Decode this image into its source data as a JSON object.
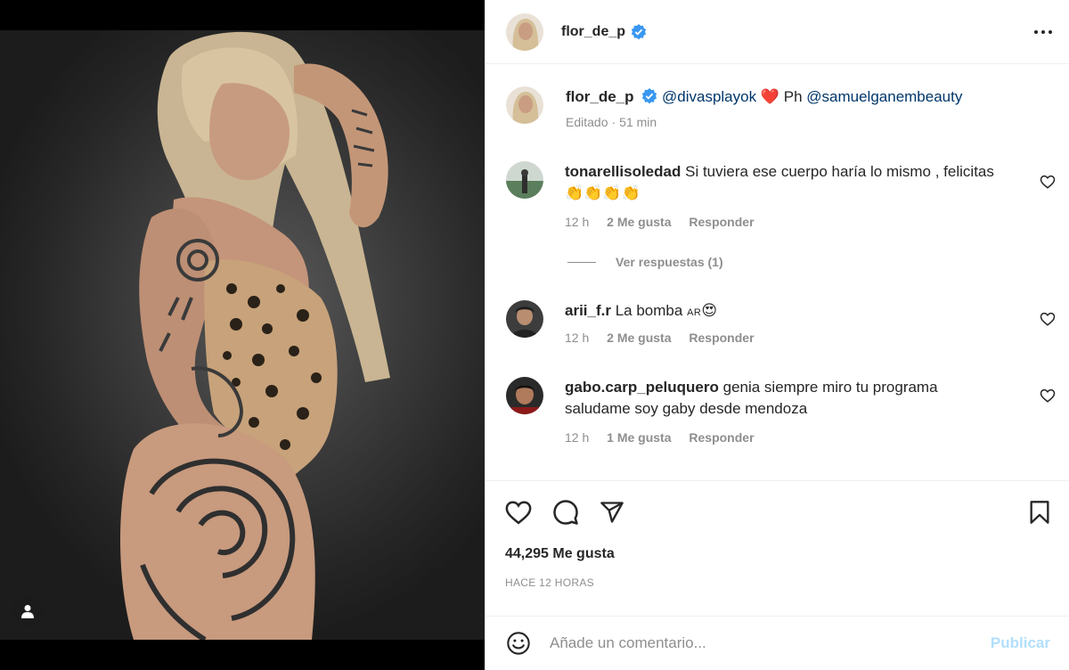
{
  "post": {
    "author": "flor_de_p",
    "verified": true,
    "caption": {
      "author": "flor_de_p",
      "mention1": "@divasplayok",
      "heart_emoji": "❤️",
      "text_mid": "Ph",
      "mention2": "@samuelganembeauty",
      "edited_label": "Editado",
      "separator": "·",
      "time": "51 min"
    }
  },
  "comments": [
    {
      "username": "tonarellisoledad",
      "text": "Si tuviera ese cuerpo haría lo mismo , felicitas",
      "emoji_line": "👏👏👏👏",
      "time": "12 h",
      "likes": "2 Me gusta",
      "reply": "Responder",
      "view_replies": "Ver respuestas (1)"
    },
    {
      "username": "arii_f.r",
      "text": "La bomba",
      "flag": "AR",
      "emoji": "😍",
      "time": "12 h",
      "likes": "2 Me gusta",
      "reply": "Responder"
    },
    {
      "username": "gabo.carp_peluquero",
      "text": "genia siempre miro tu programa",
      "text2": "saludame soy gaby desde mendoza",
      "time": "12 h",
      "likes": "1 Me gusta",
      "reply": "Responder"
    }
  ],
  "stats": {
    "likes": "44,295 Me gusta",
    "posted": "HACE 12 HORAS"
  },
  "composer": {
    "placeholder": "Añade un comentario...",
    "publish": "Publicar"
  },
  "icons": {
    "more": "more-icon",
    "like": "heart-icon",
    "comment": "comment-icon",
    "share": "share-icon",
    "save": "bookmark-icon",
    "emoji": "emoji-icon",
    "tag": "user-tag-icon",
    "verified": "verified-badge-icon"
  },
  "colors": {
    "verified": "#3897f0",
    "mention": "#00376b",
    "secondary_text": "#8e8e8e",
    "publish_disabled": "#b2dffc",
    "divider": "#efefef"
  }
}
